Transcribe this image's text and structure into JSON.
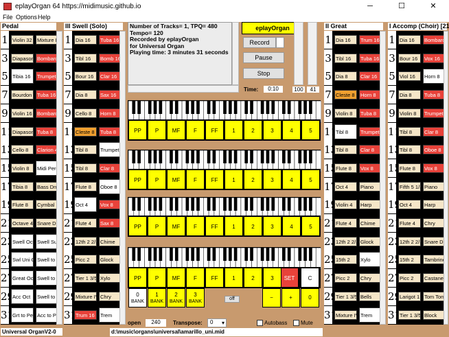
{
  "window": {
    "title": "eplayOrgan 64  https://midimusic.github.io",
    "minimize": "─",
    "maximize": "☐",
    "close": "✕"
  },
  "menu": [
    "File",
    "Options",
    "Help"
  ],
  "divisions": {
    "pedal": {
      "title": "Pedal",
      "rows": [
        {
          "num": "1",
          "a": "Violin 32",
          "b": "Mixture IV"
        },
        {
          "num": "3",
          "a": "Diapason 1",
          "b": "Bombard 32"
        },
        {
          "num": "5",
          "a": "Tibia 16",
          "b": "Trumpet 16"
        },
        {
          "num": "7",
          "a": "Bourdon 16",
          "b": "Tuba 16"
        },
        {
          "num": "9",
          "a": "Violin 16",
          "b": "Bombard 16"
        },
        {
          "num": "11",
          "a": "Diapason 8",
          "b": "Tuba 8"
        },
        {
          "num": "13",
          "a": "Cello 8",
          "b": "Clarion 4"
        },
        {
          "num": "15",
          "a": "Violin 8",
          "b": "Midi Perc"
        },
        {
          "num": "17",
          "a": "Tibia 8",
          "b": "Bass Drm"
        },
        {
          "num": "19",
          "a": "Flute 8",
          "b": "Cymbal"
        },
        {
          "num": "21",
          "a": "Octave 4",
          "b": "Snare Drm"
        },
        {
          "num": "23",
          "a": "Swell Oct",
          "b": "Swell Sub"
        },
        {
          "num": "25",
          "a": "Swl Uni Off",
          "b": "Swell to Gr"
        },
        {
          "num": "27",
          "a": "Great Oct",
          "b": "Swell to Acc"
        },
        {
          "num": "29",
          "a": "Acc Oct",
          "b": "Swell to Ped"
        },
        {
          "num": "31",
          "a": "Grt to Ped",
          "b": "Acc to Ped"
        }
      ]
    },
    "swell": {
      "title": "III Swell (Solo)",
      "rows": [
        {
          "num": "1",
          "a": "Dia 16",
          "b": "Tuba 16"
        },
        {
          "num": "3",
          "a": "Tibl 16",
          "b": "Bomb 16"
        },
        {
          "num": "5",
          "a": "Bour 16",
          "b": "Clar 16"
        },
        {
          "num": "7",
          "a": "Dia 8",
          "b": "Sax 16"
        },
        {
          "num": "9",
          "a": "Cello 8",
          "b": "Horn 8"
        },
        {
          "num": "11",
          "a": "Cleste 8",
          "b": "Tuba 8"
        },
        {
          "num": "13",
          "a": "Tibl 8",
          "b": "Trumpet 8"
        },
        {
          "num": "15",
          "a": "Tibl 8",
          "b": "Clar 8"
        },
        {
          "num": "17",
          "a": "Flute 8",
          "b": "Oboe 8"
        },
        {
          "num": "19",
          "a": "Oct 4",
          "b": "Vox 8"
        },
        {
          "num": "21",
          "a": "Flute 4",
          "b": "Sax 8"
        },
        {
          "num": "23",
          "a": "12th 2 2/3",
          "b": "Chime"
        },
        {
          "num": "25",
          "a": "Picc 2",
          "b": "Glock"
        },
        {
          "num": "27",
          "a": "Tier 1 3/5",
          "b": "Xylo"
        },
        {
          "num": "29",
          "a": "Mixture IV",
          "b": "Chry"
        },
        {
          "num": "31",
          "a": "Trum 16",
          "b": "Trem"
        }
      ]
    },
    "great": {
      "title": "II Great",
      "rows": [
        {
          "num": "1",
          "a": "Dia 16",
          "b": "Trum 16"
        },
        {
          "num": "3",
          "a": "Tibl 16",
          "b": "Tuba 16"
        },
        {
          "num": "5",
          "a": "Dia 8",
          "b": "Clar 16"
        },
        {
          "num": "7",
          "a": "Cleste 8",
          "b": "Horn 8"
        },
        {
          "num": "9",
          "a": "Violin 8",
          "b": "Tuba 8"
        },
        {
          "num": "11",
          "a": "Tibl 8",
          "b": "Trumpet 8"
        },
        {
          "num": "13",
          "a": "Tibl 8",
          "b": "Clar 8"
        },
        {
          "num": "15",
          "a": "Flute 8",
          "b": "Vox 8"
        },
        {
          "num": "17",
          "a": "Oct 4",
          "b": "Piano"
        },
        {
          "num": "19",
          "a": "Violin 4",
          "b": "Harp"
        },
        {
          "num": "21",
          "a": "Flute 4",
          "b": "Chime"
        },
        {
          "num": "23",
          "a": "12th 2 2/3",
          "b": "Glock"
        },
        {
          "num": "25",
          "a": "15th 2",
          "b": "Xylo"
        },
        {
          "num": "27",
          "a": "Picc 2",
          "b": "Chry"
        },
        {
          "num": "29",
          "a": "Tier 1 3/5",
          "b": "Bells"
        },
        {
          "num": "31",
          "a": "Mixture IV",
          "b": "Trem"
        }
      ]
    },
    "accomp": {
      "title": "I Accomp (Choir) [21]",
      "rows": [
        {
          "num": "1",
          "a": "Dia 16",
          "b": "Bombard 1"
        },
        {
          "num": "3",
          "a": "Bour 16",
          "b": "Vox 16"
        },
        {
          "num": "5",
          "a": "Viol 16",
          "b": "Horn 8"
        },
        {
          "num": "7",
          "a": "Dia 8",
          "b": "Tuba 8"
        },
        {
          "num": "9",
          "a": "Violin 8",
          "b": "Trumpet 8"
        },
        {
          "num": "11",
          "a": "Tibl 8",
          "b": "Clar 8"
        },
        {
          "num": "13",
          "a": "Tibl 8",
          "b": "Oboe 8"
        },
        {
          "num": "15",
          "a": "Flute 8",
          "b": "Vox 8"
        },
        {
          "num": "17",
          "a": "Fifth 5 1/3",
          "b": "Piano"
        },
        {
          "num": "19",
          "a": "Oct 4",
          "b": "Harp"
        },
        {
          "num": "21",
          "a": "Flute 4",
          "b": "Chry"
        },
        {
          "num": "23",
          "a": "12th 2 2/3",
          "b": "Snare Drm"
        },
        {
          "num": "25",
          "a": "15th 2",
          "b": "Tambrine"
        },
        {
          "num": "27",
          "a": "Picc 2",
          "b": "Castanet"
        },
        {
          "num": "29",
          "a": "Larigot 1 1/",
          "b": "Tom Tom"
        },
        {
          "num": "31",
          "a": "Tier 1 3/5",
          "b": "Block"
        }
      ]
    }
  },
  "info_text": "Number of Tracks= 1, TPQ= 480\nTempo= 120\nRecorded by eplayOrgan\nfor Universal Organ\nPlaying time: 3 minutes 31 seconds",
  "controls": {
    "eplay_btn": "eplayOrgan",
    "record": "Record",
    "pause": "Pause",
    "stop": "Stop",
    "time_label": "Time:",
    "time_value": "0:10",
    "vol1": "100",
    "vol2": "41"
  },
  "presets": [
    "PP",
    "P",
    "MF",
    "F",
    "FF",
    "1",
    "2",
    "3",
    "4",
    "5"
  ],
  "bottom_presets": [
    "PP",
    "P",
    "MF",
    "F",
    "FF",
    "1",
    "2",
    "3"
  ],
  "set_label": "SET",
  "c_label": "C",
  "banks": [
    {
      "n": "0",
      "l": "BANK"
    },
    {
      "n": "1",
      "l": "BANK"
    },
    {
      "n": "2",
      "l": "BANK"
    },
    {
      "n": "3",
      "l": "BANK"
    }
  ],
  "off_label": "off",
  "minus": "−",
  "plus": "+",
  "zero": "0",
  "status": {
    "organ": "Universal OrganV2-0",
    "open_label": "open",
    "open_value": "240",
    "transpose_label": "Transpose:",
    "transpose_value": "0",
    "autobass": "Autobass",
    "mute": "Mute",
    "path": "d:\\music\\organs\\universal\\amarillo_uni.mid"
  },
  "colors": {
    "bg": "#c89a6e",
    "on": "#e8423a",
    "orange": "#f0a030",
    "preset": "#ffff00"
  }
}
